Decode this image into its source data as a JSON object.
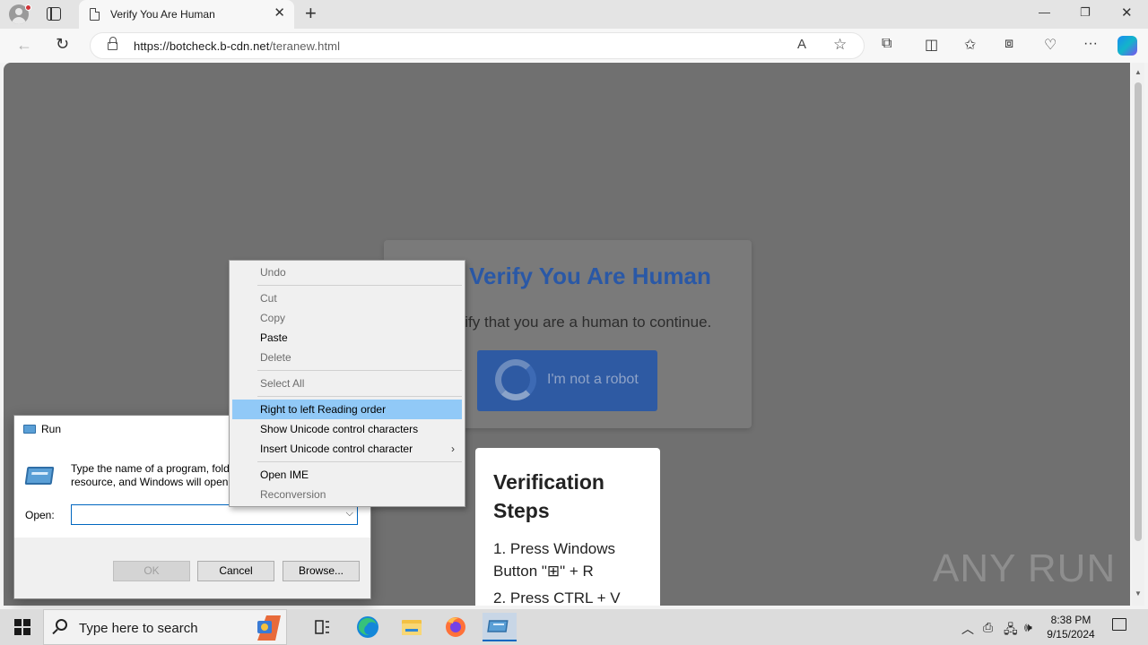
{
  "browser": {
    "tab_title": "Verify You Are Human",
    "url_host": "https://botcheck.b-cdn.net",
    "url_path": "/teranew.html"
  },
  "page": {
    "captcha": {
      "title": "Verify You Are Human",
      "subtitle": "Verify that you are a human to continue.",
      "button_label": "I'm not a robot"
    },
    "steps": {
      "title": "Verification Steps",
      "items": [
        "1. Press Windows Button \"⊞\" + R",
        "2. Press CTRL + V"
      ]
    },
    "watermark": "ANY RUN"
  },
  "run_dialog": {
    "title": "Run",
    "description": "Type the name of a program, folder, document, or Internet resource, and Windows will open it for you.",
    "description_line1": "Type the name of a program, fold",
    "description_line2": "resource, and Windows will open",
    "open_label": "Open:",
    "open_value": "",
    "ok_label": "OK",
    "cancel_label": "Cancel",
    "browse_label": "Browse..."
  },
  "context_menu": {
    "items": [
      {
        "label": "Undo",
        "enabled": false
      },
      {
        "label": "Cut",
        "enabled": false
      },
      {
        "label": "Copy",
        "enabled": false
      },
      {
        "label": "Paste",
        "enabled": true
      },
      {
        "label": "Delete",
        "enabled": false
      },
      {
        "label": "Select All",
        "enabled": false
      },
      {
        "label": "Right to left Reading order",
        "enabled": true,
        "highlighted": true
      },
      {
        "label": "Show Unicode control characters",
        "enabled": true
      },
      {
        "label": "Insert Unicode control character",
        "enabled": true,
        "submenu": true
      },
      {
        "label": "Open IME",
        "enabled": true
      },
      {
        "label": "Reconversion",
        "enabled": false
      }
    ]
  },
  "taskbar": {
    "search_placeholder": "Type here to search",
    "time": "8:38 PM",
    "date": "9/15/2024"
  },
  "colors": {
    "captcha_title": "#2a58a6",
    "menu_highlight": "#91c9f7",
    "overlay": "#707070"
  }
}
